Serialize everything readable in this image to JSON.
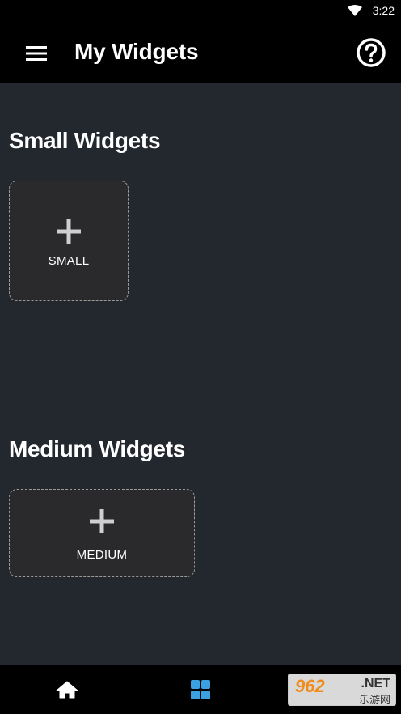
{
  "status_bar": {
    "time": "3:22",
    "wifi_icon": "wifi-icon"
  },
  "app_bar": {
    "title": "My Widgets",
    "menu_icon": "hamburger-menu-icon",
    "help_icon": "help-circle-icon"
  },
  "sections": {
    "small": {
      "title": "Small Widgets",
      "tile_label": "SMALL"
    },
    "medium": {
      "title": "Medium Widgets",
      "tile_label": "MEDIUM"
    }
  },
  "bottom_nav": {
    "items": [
      {
        "icon": "home-icon",
        "active": false
      },
      {
        "icon": "grid-icon",
        "active": true
      }
    ],
    "active_color": "#3aa0e0"
  },
  "watermark": {
    "main": "962",
    "net": ".NET",
    "sub": "乐游网"
  },
  "colors": {
    "background": "#23272e",
    "bars": "#000000",
    "tile": "#2a2a2c"
  }
}
